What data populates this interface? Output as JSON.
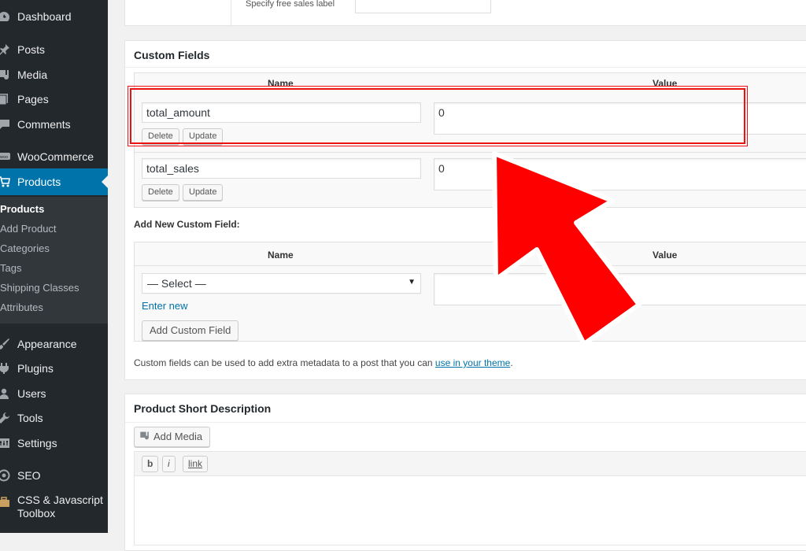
{
  "sidebar": {
    "items": [
      {
        "label": "Dashboard",
        "icon": "dashboard-icon"
      },
      {
        "label": "Posts",
        "icon": "pin-icon"
      },
      {
        "label": "Media",
        "icon": "media-icon"
      },
      {
        "label": "Pages",
        "icon": "pages-icon"
      },
      {
        "label": "Comments",
        "icon": "comment-icon"
      },
      {
        "label": "WooCommerce",
        "icon": "woocommerce-icon"
      },
      {
        "label": "Products",
        "icon": "cart-icon"
      },
      {
        "label": "Appearance",
        "icon": "brush-icon"
      },
      {
        "label": "Plugins",
        "icon": "plugin-icon"
      },
      {
        "label": "Users",
        "icon": "users-icon"
      },
      {
        "label": "Tools",
        "icon": "wrench-icon"
      },
      {
        "label": "Settings",
        "icon": "settings-icon"
      },
      {
        "label": "SEO",
        "icon": "seo-icon"
      },
      {
        "label": "CSS & Javascript Toolbox",
        "icon": "toolbox-icon"
      }
    ],
    "current": "Products",
    "submenu": [
      "Products",
      "Add Product",
      "Categories",
      "Tags",
      "Shipping Classes",
      "Attributes"
    ]
  },
  "top_panel": {
    "label": "Specify free sales label",
    "input_value": ""
  },
  "custom_fields": {
    "title": "Custom Fields",
    "col_name": "Name",
    "col_value": "Value",
    "rows": [
      {
        "name": "total_amount",
        "value": "0",
        "delete_label": "Delete",
        "update_label": "Update"
      },
      {
        "name": "total_sales",
        "value": "0",
        "delete_label": "Delete",
        "update_label": "Update"
      }
    ],
    "add_new": {
      "heading": "Add New Custom Field:",
      "col_name": "Name",
      "col_value": "Value",
      "select_value": "— Select —",
      "enter_new": "Enter new",
      "add_button": "Add Custom Field"
    },
    "help_text": "Custom fields can be used to add extra metadata to a post that you can",
    "help_link": "use in your theme",
    "help_end": "."
  },
  "short_description": {
    "title": "Product Short Description",
    "add_media": "Add Media",
    "toolbar": [
      "b",
      "i",
      "link"
    ]
  },
  "annotation": {
    "highlight_color": "#e11111",
    "arrow_color": "#ff0000"
  }
}
